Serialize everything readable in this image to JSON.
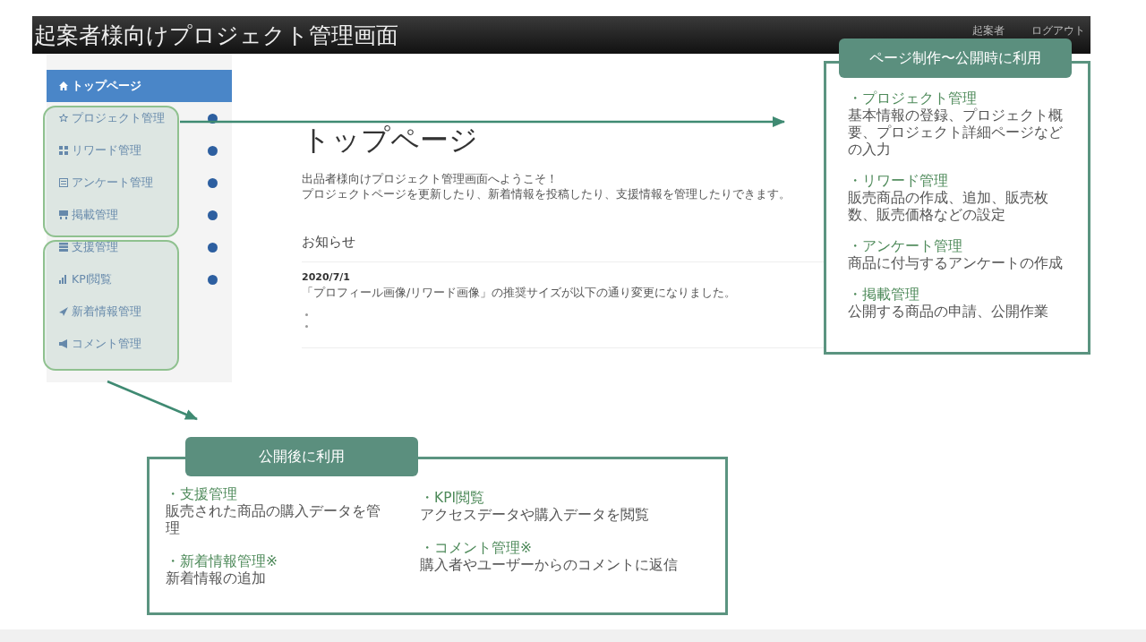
{
  "header": {
    "title": "起案者様向けプロジェクト管理画面",
    "user": "起案者",
    "logout": "ログアウト"
  },
  "sidebar": {
    "items": [
      {
        "label": "トップページ",
        "selected": true,
        "help": false
      },
      {
        "label": "プロジェクト管理",
        "selected": false,
        "help": true
      },
      {
        "label": "リワード管理",
        "selected": false,
        "help": true
      },
      {
        "label": "アンケート管理",
        "selected": false,
        "help": true
      },
      {
        "label": "掲載管理",
        "selected": false,
        "help": true
      },
      {
        "label": "支援管理",
        "selected": false,
        "help": true
      },
      {
        "label": "KPI閲覧",
        "selected": false,
        "help": true
      },
      {
        "label": "新着情報管理",
        "selected": false,
        "help": false
      },
      {
        "label": "コメント管理",
        "selected": false,
        "help": false
      }
    ]
  },
  "main": {
    "title": "トップページ",
    "intro": [
      "出品者様向けプロジェクト管理画面へようこそ！",
      "プロジェクトページを更新したり、新着情報を投稿したり、支援情報を管理したりできます。"
    ],
    "notices_heading": "お知らせ",
    "notices": [
      {
        "date": "2020/7/1",
        "text": "「プロフィール画像/リワード画像」の推奨サイズが以下の通り変更になりました。"
      }
    ]
  },
  "callouts": [
    {
      "title": "ページ制作〜公開時に利用",
      "groups": [
        {
          "heading": "・プロジェクト管理",
          "text": "基本情報の登録、プロジェクト概要、プロジェクト詳細ページなどの入力"
        },
        {
          "heading": "・リワード管理",
          "text": "販売商品の作成、追加、販売枚数、販売価格などの設定"
        },
        {
          "heading": "・アンケート管理",
          "text": "商品に付与するアンケートの作成"
        },
        {
          "heading": "・掲載管理",
          "text": "公開する商品の申請、公開作業"
        }
      ]
    },
    {
      "title": "公開後に利用",
      "groups": [
        {
          "heading": "・支援管理",
          "text": "販売された商品の購入データを管理"
        },
        {
          "heading": "・新着情報管理※",
          "text": "新着情報の追加"
        },
        {
          "heading": "・KPI閲覧",
          "text": "アクセスデータや購入データを閲覧"
        },
        {
          "heading": "・コメント管理※",
          "text": "購入者やユーザーからのコメントに返信"
        }
      ]
    }
  ]
}
